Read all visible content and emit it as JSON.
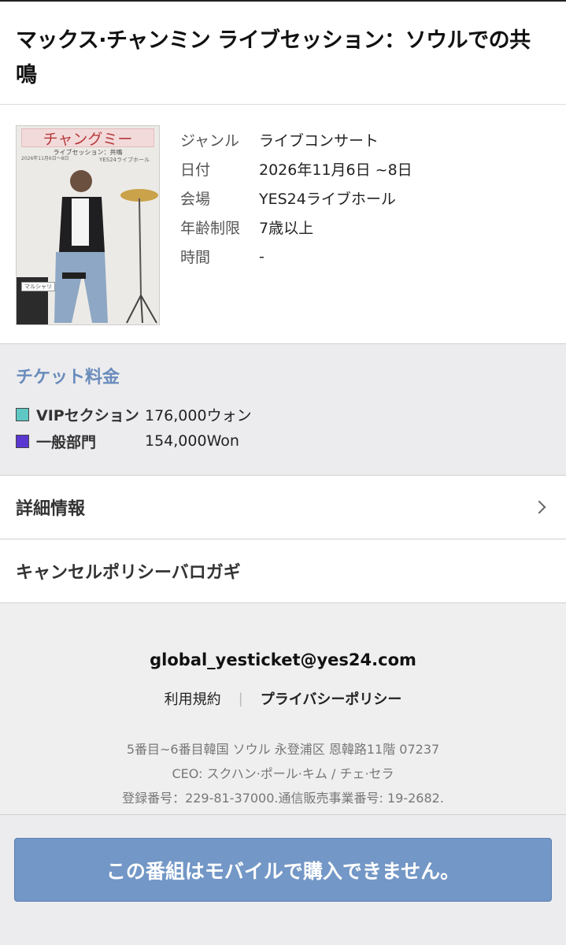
{
  "event": {
    "title": "マックス·チャンミン ライブセッション：ソウルでの共鳴"
  },
  "poster": {
    "title": "チャングミー",
    "subtitle": "ライブセッション：共鳴",
    "small_text": "2026年11月6日〜8日",
    "venue_text": "YES24ライブホール",
    "tag": "マルシャリ"
  },
  "details": [
    {
      "label": "ジャンル",
      "value": "ライブコンサート"
    },
    {
      "label": "日付",
      "value": "2026年11月6日 ~8日"
    },
    {
      "label": "会場",
      "value": "YES24ライブホール"
    },
    {
      "label": "年齢制限",
      "value": "7歳以上"
    },
    {
      "label": "時間",
      "value": "-"
    }
  ],
  "prices": {
    "heading": "チケット料金",
    "items": [
      {
        "label": "VIPセクション",
        "value": "176,000ウォン",
        "color": "#5ec6c3"
      },
      {
        "label": "一般部門",
        "value": "154,000Won",
        "color": "#5a37d1"
      }
    ]
  },
  "sections": {
    "details_label": "詳細情報",
    "cancel_label": "キャンセルポリシーバロガギ"
  },
  "footer": {
    "email": "global_yesticket@yes24.com",
    "terms": "利用規約",
    "privacy": "プライバシーポリシー",
    "address": "5番目~6番目韓国 ソウル 永登浦区 恩韓路11階 07237",
    "ceo": "CEO: スクハン·ポール·キム / チェ·セラ",
    "registration": "登録番号：229-81-37000.通信販売事業番号: 19-2682."
  },
  "buy_button": {
    "label": "この番組はモバイルで購入できません。"
  },
  "colors": {
    "accent": "#6a8cbc",
    "button": "#7397c6"
  }
}
